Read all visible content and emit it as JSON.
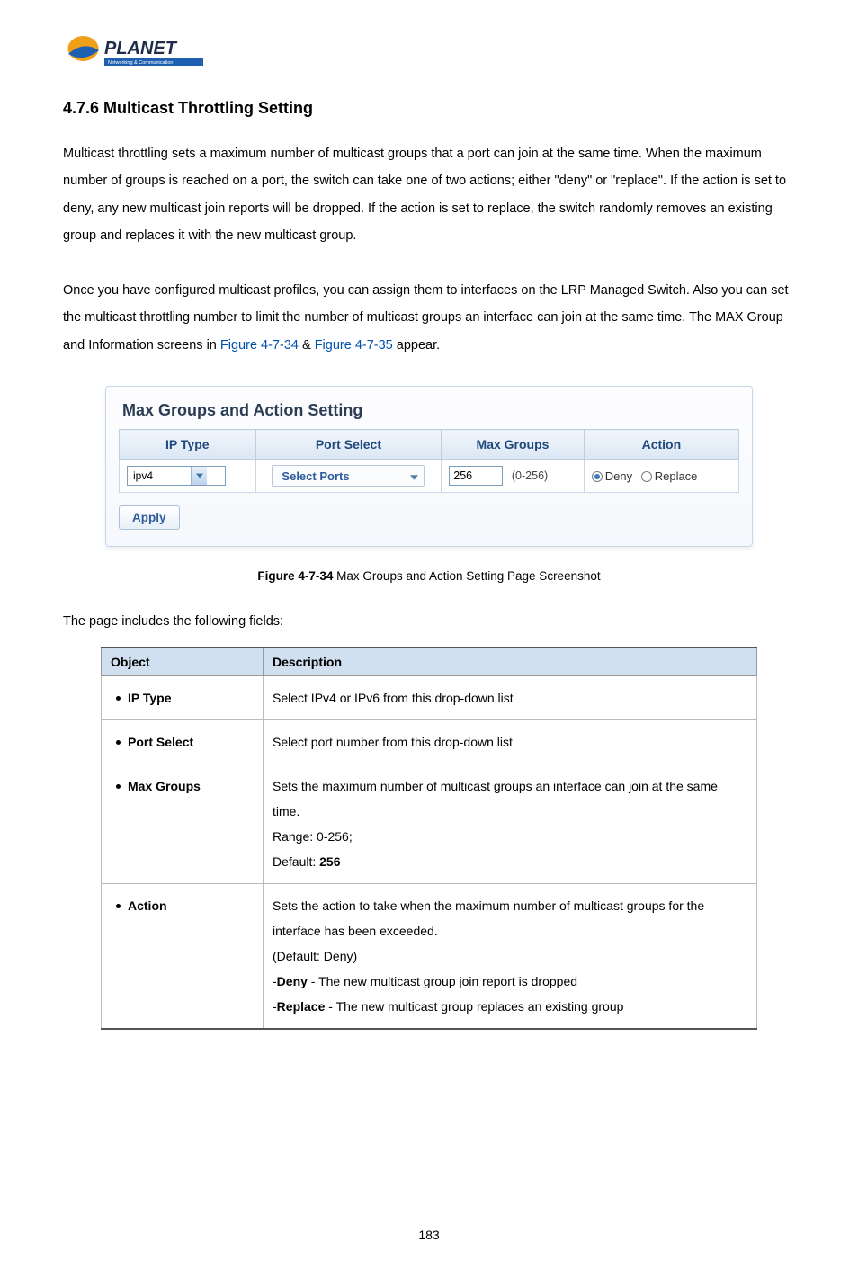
{
  "logo": {
    "brand": "PLANET",
    "tagline": "Networking & Communication"
  },
  "heading": "4.7.6 Multicast Throttling Setting",
  "paragraph1": "Multicast throttling sets a maximum number of multicast groups that a port can join at the same time. When the maximum number of groups is reached on a port, the switch can take one of two actions; either \"deny\" or \"replace\". If the action is set to deny, any new multicast join reports will be dropped. If the action is set to replace, the switch randomly removes an existing group and replaces it with the new multicast group.",
  "paragraph2_pre": "Once you have configured multicast profiles, you can assign them to interfaces on the LRP Managed Switch. Also you can set the multicast throttling number to limit the number of multicast groups an interface can join at the same time. The MAX Group and Information screens in ",
  "paragraph2_link1": "Figure 4-7-34",
  "paragraph2_mid": " & ",
  "paragraph2_link2": "Figure 4-7-35",
  "paragraph2_post": " appear.",
  "panel": {
    "title": "Max Groups and Action Setting",
    "headers": {
      "col1": "IP Type",
      "col2": "Port Select",
      "col3": "Max Groups",
      "col4": "Action"
    },
    "ip_type_value": "ipv4",
    "port_select_label": "Select Ports",
    "max_groups_value": "256",
    "max_groups_hint": "(0-256)",
    "action_deny": "Deny",
    "action_replace": "Replace",
    "apply_label": "Apply"
  },
  "figure_caption_bold": "Figure 4-7-34",
  "figure_caption_rest": " Max Groups and Action Setting Page Screenshot",
  "fields_intro": "The page includes the following fields:",
  "spec_headers": {
    "object": "Object",
    "description": "Description"
  },
  "spec_rows": {
    "r0": {
      "object": "IP Type",
      "desc": "Select IPv4 or IPv6 from this drop-down list"
    },
    "r1": {
      "object": "Port Select",
      "desc": "Select port number from this drop-down list"
    },
    "r2": {
      "object": "Max Groups",
      "l1": "Sets the maximum number of multicast groups an interface can join at the same",
      "l2": "time.",
      "l3": "Range: 0-256;",
      "l4_pre": "Default: ",
      "l4_b": "256"
    },
    "r3": {
      "object": "Action",
      "l1": "Sets the action to take when the maximum number of multicast groups for the",
      "l2": "interface has been exceeded.",
      "l3": "(Default: Deny)",
      "l4_pre": "-",
      "l4_b": "Deny",
      "l4_post": " - The new multicast group join report is dropped",
      "l5_pre": "-",
      "l5_b": "Replace",
      "l5_post": " - The new multicast group replaces an existing group"
    }
  },
  "page_number": "183"
}
